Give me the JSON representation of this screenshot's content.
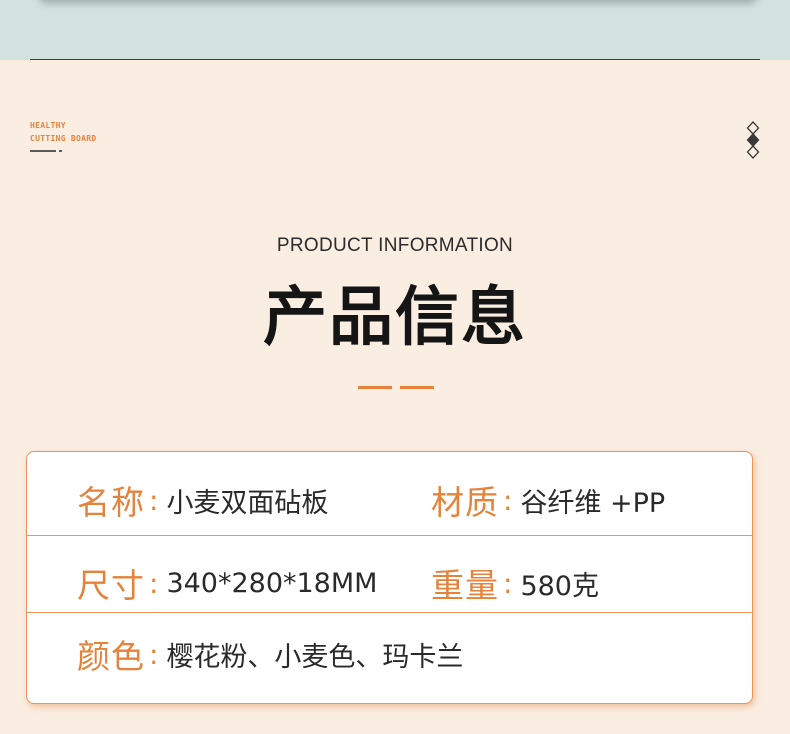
{
  "brand": {
    "line1": "HEALTHY",
    "line2": "CUTTING BOARD"
  },
  "header": {
    "en_title": "PRODUCT INFORMATION",
    "cn_title": "产品信息"
  },
  "colors": {
    "accent": "#e6823a",
    "background": "#faeee2",
    "top_band": "#d3e2df"
  },
  "icons": {
    "decor": "diamond-chain-icon"
  },
  "info": {
    "name_label": "名称",
    "name_value": "小麦双面砧板",
    "material_label": "材质",
    "material_value": "谷纤维 +PP",
    "size_label": "尺寸",
    "size_value": "340*280*18MM",
    "weight_label": "重量",
    "weight_value": "580克",
    "color_label": "颜色",
    "color_value": "樱花粉、小麦色、玛卡兰",
    "colon": ":"
  }
}
